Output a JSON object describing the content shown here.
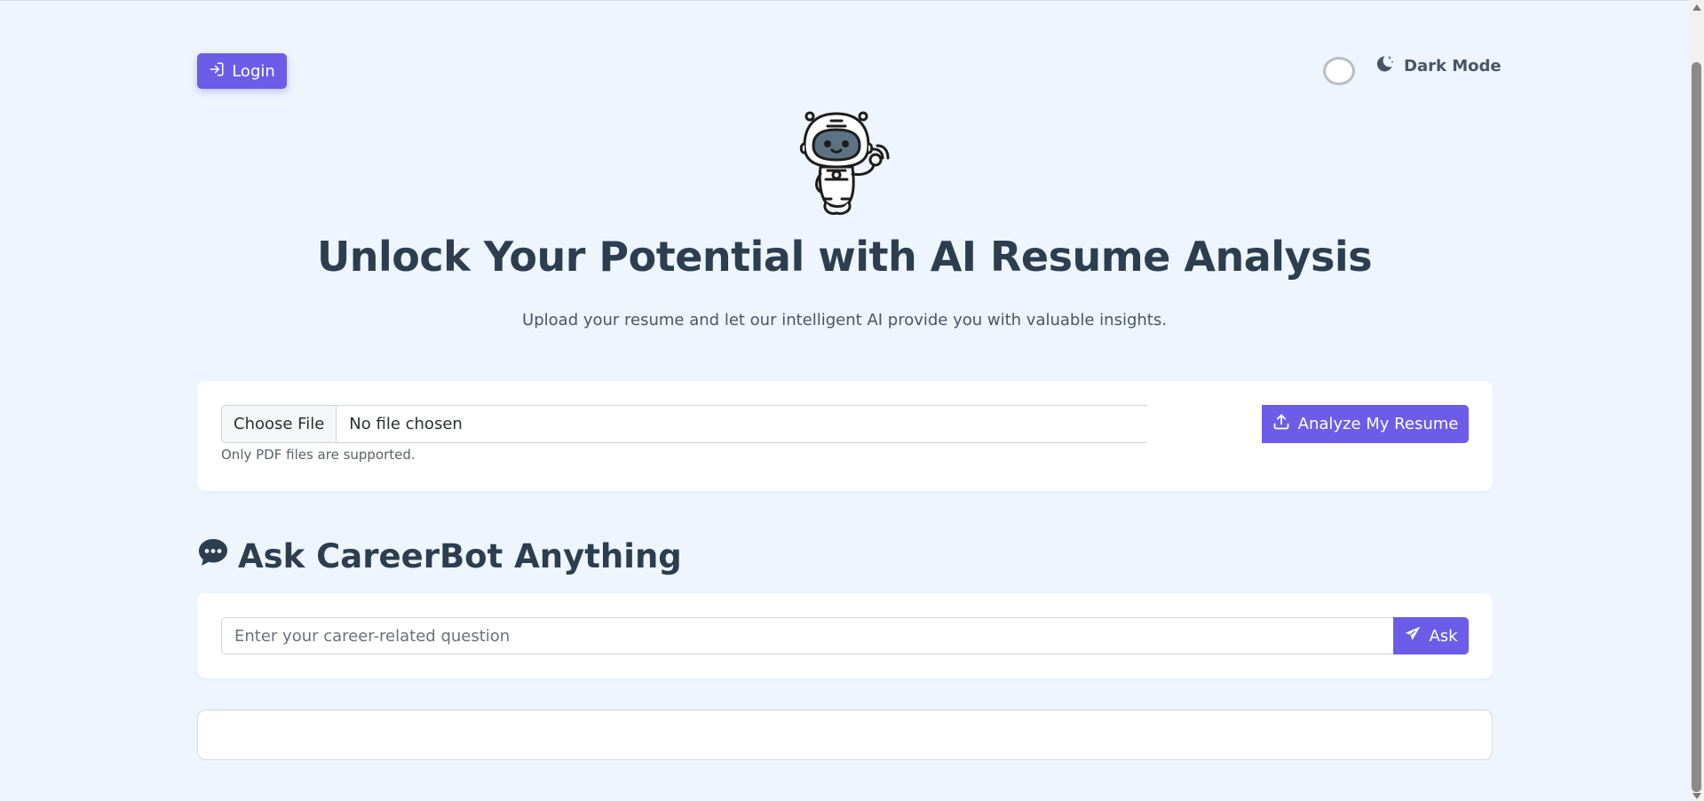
{
  "header": {
    "login_label": "Login",
    "dark_mode_label": "Dark Mode"
  },
  "hero": {
    "title": "Unlock Your Potential with AI Resume Analysis",
    "subtitle": "Upload your resume and let our intelligent AI provide you with valuable insights."
  },
  "upload": {
    "choose_label": "Choose File",
    "status": "No file chosen",
    "analyze_label": "Analyze My Resume",
    "hint": "Only PDF files are supported."
  },
  "chat": {
    "title": "Ask CareerBot Anything",
    "placeholder": "Enter your career-related question",
    "ask_label": "Ask"
  },
  "colors": {
    "accent": "#6c5ce7",
    "background": "#eef5fd",
    "heading": "#2c3e50"
  },
  "icons": {
    "login": "sign-in-icon",
    "dark_mode": "moon-stars-icon",
    "analyze": "upload-icon",
    "chat": "comment-dots-icon",
    "ask": "paper-plane-icon",
    "mascot": "robot-mascot"
  }
}
